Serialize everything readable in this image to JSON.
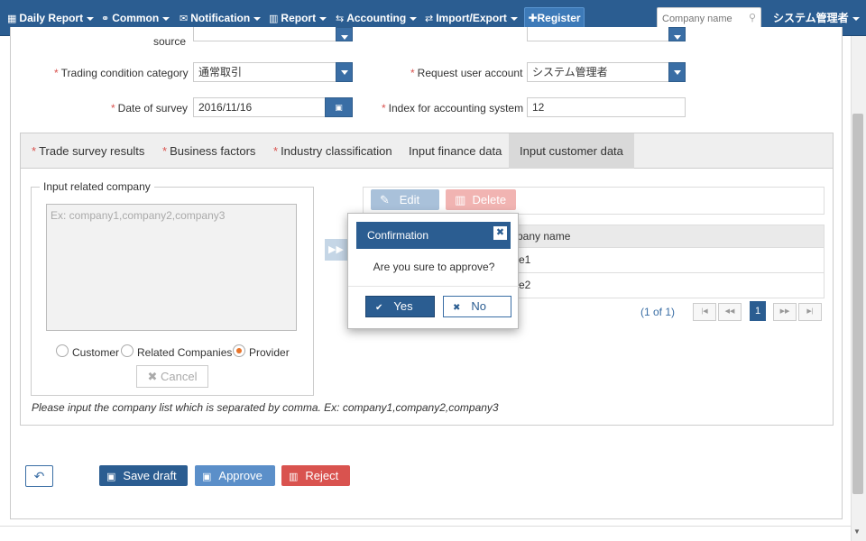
{
  "navbar": {
    "daily_report": "Daily Report",
    "common": "Common",
    "notification": "Notification",
    "report": "Report",
    "accounting": "Accounting",
    "import_export": "Import/Export",
    "register": "Register",
    "company_search_placeholder": "Company name",
    "user": "システム管理者",
    "icons": [
      "calendar-icon",
      "users-icon",
      "envelope-icon",
      "bar-chart-icon",
      "exchange-icon",
      "transfer-icon",
      "plus-icon",
      "search-icon"
    ]
  },
  "form": {
    "source_label": "source",
    "trading_condition_label": "Trading condition category",
    "trading_condition_value": "通常取引",
    "request_user_label": "Request user account",
    "request_user_value": "システム管理者",
    "date_of_survey_label": "Date of survey",
    "date_of_survey_value": "2016/11/16",
    "index_accounting_label": "Index for accounting system",
    "index_accounting_value": "12"
  },
  "tabs": [
    {
      "label": "Trade survey results",
      "required": true
    },
    {
      "label": "Business factors",
      "required": true
    },
    {
      "label": "Industry classification",
      "required": true
    },
    {
      "label": "Input finance data",
      "required": false
    },
    {
      "label": "Input customer data",
      "required": false,
      "active": true
    }
  ],
  "related": {
    "legend": "Input related company",
    "placeholder": "Ex: company1,company2,company3",
    "radio_customer": "Customer",
    "radio_related": "Related Companies",
    "radio_provider": "Provider",
    "selected": "Provider",
    "cancel": "Cancel",
    "hint": "Please input the company list which is separated by comma. Ex: company1,company2,company3"
  },
  "grid": {
    "edit": "Edit",
    "delete": "Delete",
    "header_partial": "pany name",
    "row1_partial": "e1",
    "row2_partial": "e2",
    "pager_text": "(1 of 1)",
    "current_page": "1"
  },
  "actions": {
    "save_draft": "Save draft",
    "approve": "Approve",
    "reject": "Reject"
  },
  "modal": {
    "title": "Confirmation",
    "message": "Are you sure to approve?",
    "yes": "Yes",
    "no": "No"
  },
  "colors": {
    "navbar": "#2b5d91",
    "primary": "#3a6ea5",
    "danger": "#d9534f",
    "radio_checked": "#e8742a"
  }
}
